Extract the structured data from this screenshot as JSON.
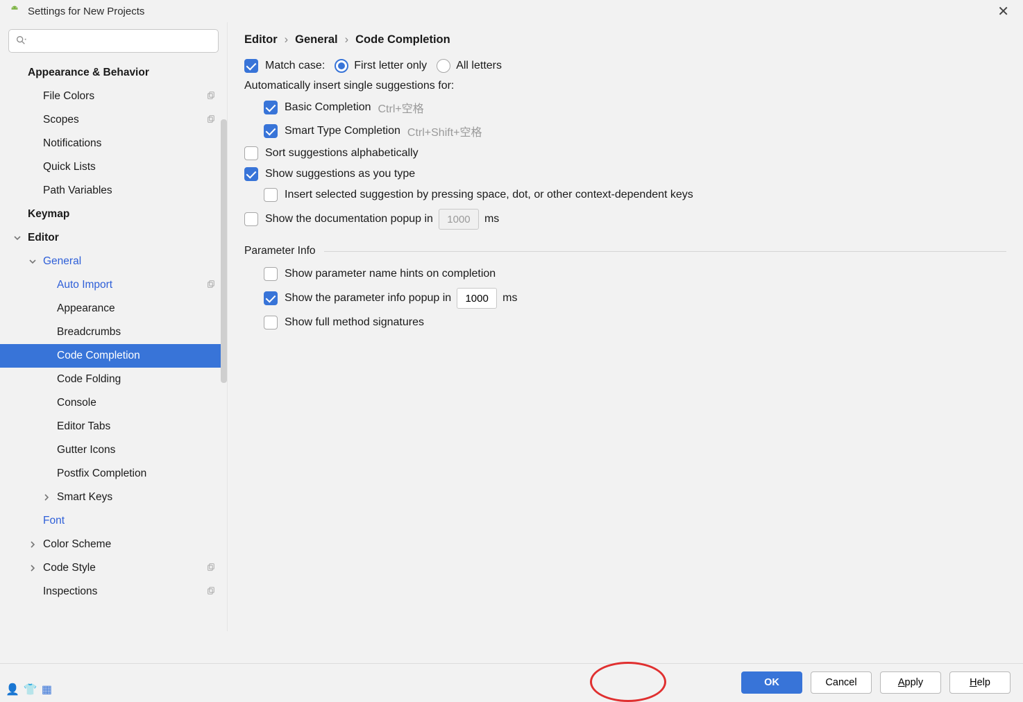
{
  "window": {
    "title": "Settings for New Projects"
  },
  "search": {
    "placeholder": ""
  },
  "sidebar": {
    "items": [
      {
        "label": "Appearance & Behavior",
        "depth": 1,
        "bold": true,
        "arrow": ""
      },
      {
        "label": "File Colors",
        "depth": 2,
        "dup": true
      },
      {
        "label": "Scopes",
        "depth": 2,
        "dup": true
      },
      {
        "label": "Notifications",
        "depth": 2
      },
      {
        "label": "Quick Lists",
        "depth": 2
      },
      {
        "label": "Path Variables",
        "depth": 2
      },
      {
        "label": "Keymap",
        "depth": 1,
        "bold": true
      },
      {
        "label": "Editor",
        "depth": 1,
        "bold": true,
        "arrow": "down"
      },
      {
        "label": "General",
        "depth": 2,
        "link": true,
        "arrow": "down"
      },
      {
        "label": "Auto Import",
        "depth": 3,
        "link": true,
        "dup": true
      },
      {
        "label": "Appearance",
        "depth": 3
      },
      {
        "label": "Breadcrumbs",
        "depth": 3
      },
      {
        "label": "Code Completion",
        "depth": 3,
        "selected": true
      },
      {
        "label": "Code Folding",
        "depth": 3
      },
      {
        "label": "Console",
        "depth": 3
      },
      {
        "label": "Editor Tabs",
        "depth": 3
      },
      {
        "label": "Gutter Icons",
        "depth": 3
      },
      {
        "label": "Postfix Completion",
        "depth": 3
      },
      {
        "label": "Smart Keys",
        "depth": 3,
        "arrow": "right"
      },
      {
        "label": "Font",
        "depth": 2,
        "link": true
      },
      {
        "label": "Color Scheme",
        "depth": 2,
        "arrow": "right"
      },
      {
        "label": "Code Style",
        "depth": 2,
        "arrow": "right",
        "dup": true
      },
      {
        "label": "Inspections",
        "depth": 2,
        "dup": true
      }
    ]
  },
  "breadcrumb": [
    "Editor",
    "General",
    "Code Completion"
  ],
  "opts": {
    "match_case_label": "Match case:",
    "first_letter": "First letter only",
    "all_letters": "All letters",
    "auto_insert_header": "Automatically insert single suggestions for:",
    "basic_completion": "Basic Completion",
    "basic_shortcut": "Ctrl+空格",
    "smart_completion": "Smart Type Completion",
    "smart_shortcut": "Ctrl+Shift+空格",
    "sort_alpha": "Sort suggestions alphabetically",
    "show_as_type": "Show suggestions as you type",
    "insert_selected": "Insert selected suggestion by pressing space, dot, or other context-dependent keys",
    "show_doc_popup": "Show the documentation popup in",
    "doc_ms_value": "1000",
    "ms": "ms",
    "param_section": "Parameter Info",
    "show_param_hints": "Show parameter name hints on completion",
    "show_param_popup": "Show the parameter info popup in",
    "param_ms_value": "1000",
    "show_full_sig": "Show full method signatures"
  },
  "buttons": {
    "ok": "OK",
    "cancel": "Cancel",
    "apply": "Apply",
    "help": "Help"
  }
}
